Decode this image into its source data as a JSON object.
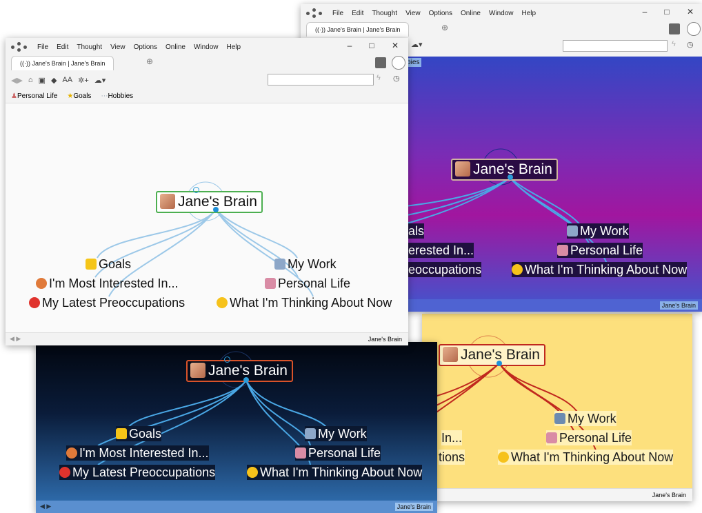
{
  "menu": [
    "File",
    "Edit",
    "Thought",
    "View",
    "Options",
    "Online",
    "Window",
    "Help"
  ],
  "window_controls": {
    "minimize": "–",
    "maximize": "□",
    "close": "✕"
  },
  "tab": {
    "label": "Jane's Brain | Jane's Brain",
    "plus": "⊕"
  },
  "bookmarks": [
    {
      "label": "Personal Life",
      "icon": "person-icon"
    },
    {
      "label": "Goals",
      "icon": "star-icon"
    },
    {
      "label": "Hobbies",
      "icon": "hobbies-icon"
    }
  ],
  "bookmark_partial": "obbies",
  "central_thought": "Jane's Brain",
  "statusbar_crumb": "Jane's Brain",
  "thoughts": {
    "goals": "Goals",
    "interested": "I'm Most Interested In...",
    "preoccupations": "My Latest Preoccupations",
    "work": "My Work",
    "personal": "Personal Life",
    "thinking": "What I'm Thinking About Now"
  },
  "partial_thoughts": {
    "purple_goals": "als",
    "purple_interested": "erested In...",
    "purple_preocc": "eoccupations",
    "yellow_interested": "In...",
    "yellow_preocc": "tions"
  },
  "colors": {
    "purple_top": "#3346c4",
    "purple_bottom": "#a1169f",
    "dark_top": "#02060f",
    "dark_bottom": "#2d69a8",
    "yellow": "#fde07d",
    "link_light": "#9cc8e8",
    "link_red": "#c0281e",
    "link_blue": "#4aa8e6"
  }
}
